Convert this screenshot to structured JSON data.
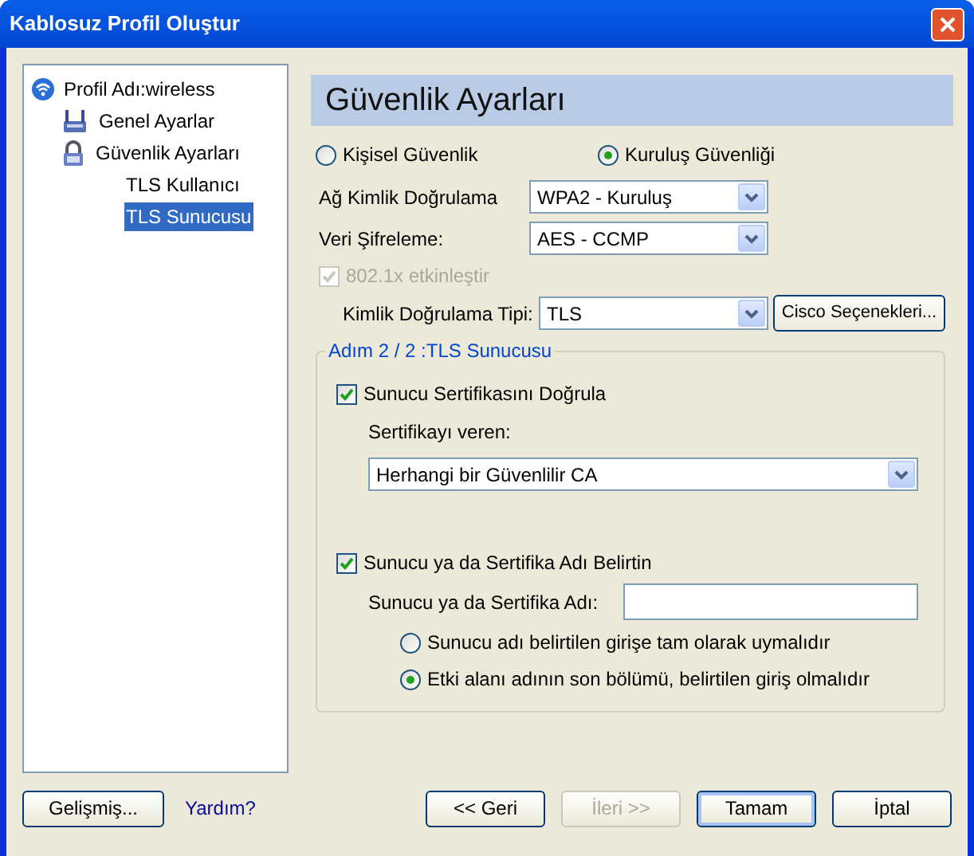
{
  "window": {
    "title": "Kablosuz Profil Oluştur"
  },
  "tree": [
    {
      "label": "Profil Adı:wireless",
      "kind": "network",
      "selected": false,
      "children": [
        {
          "label": "Genel Ayarlar",
          "kind": "adapter",
          "selected": false
        },
        {
          "label": "Güvenlik Ayarları",
          "kind": "security",
          "selected": false,
          "children": [
            {
              "label": "TLS Kullanıcı",
              "kind": "plain",
              "selected": false
            },
            {
              "label": "TLS Sunucusu",
              "kind": "plain",
              "selected": true
            }
          ]
        }
      ]
    }
  ],
  "section_title": "Güvenlik Ayarları",
  "security_modes": [
    {
      "label": "Kişisel Güvenlik",
      "selected": false
    },
    {
      "label": "Kuruluş Güvenliği",
      "selected": true
    }
  ],
  "fields": [
    {
      "label": "Ağ Kimlik Doğrulama",
      "value": "WPA2 - Kuruluş"
    },
    {
      "label": "Veri Şifreleme:",
      "value": "AES - CCMP"
    }
  ],
  "enable_8021x": {
    "label": "802.1x etkinleştir",
    "checked": true,
    "disabled": true
  },
  "auth_type": {
    "label": "Kimlik Doğrulama Tipi:",
    "value": "TLS",
    "button": "Cisco Seçenekleri..."
  },
  "group": {
    "title": "Adım 2 / 2 :TLS Sunucusu",
    "verify": {
      "label": "Sunucu Sertifikasını Doğrula",
      "checked": true
    },
    "issuer_label": "Sertifikayı veren:",
    "issuer_value": "Herhangi bir Güvenlilir CA",
    "specify": {
      "label": "Sunucu ya da Sertifika Adı Belirtin",
      "checked": true
    },
    "name_label": "Sunucu ya da Sertifika Adı:",
    "match_options": [
      {
        "label": "Sunucu adı belirtilen girişe tam olarak uymalıdır",
        "selected": false
      },
      {
        "label": "Etki alanı adının son bölümü, belirtilen giriş olmalıdır",
        "selected": true
      }
    ]
  },
  "footer_left": [
    {
      "label": "Gelişmiş...",
      "kind": "button"
    },
    {
      "label": "Yardım?",
      "kind": "link"
    }
  ],
  "buttons": [
    {
      "label": "<< Geri",
      "disabled": false,
      "default": false
    },
    {
      "label": "İleri >>",
      "disabled": true,
      "default": false
    },
    {
      "label": "Tamam",
      "disabled": false,
      "default": true
    },
    {
      "label": "İptal",
      "disabled": false,
      "default": false
    }
  ]
}
